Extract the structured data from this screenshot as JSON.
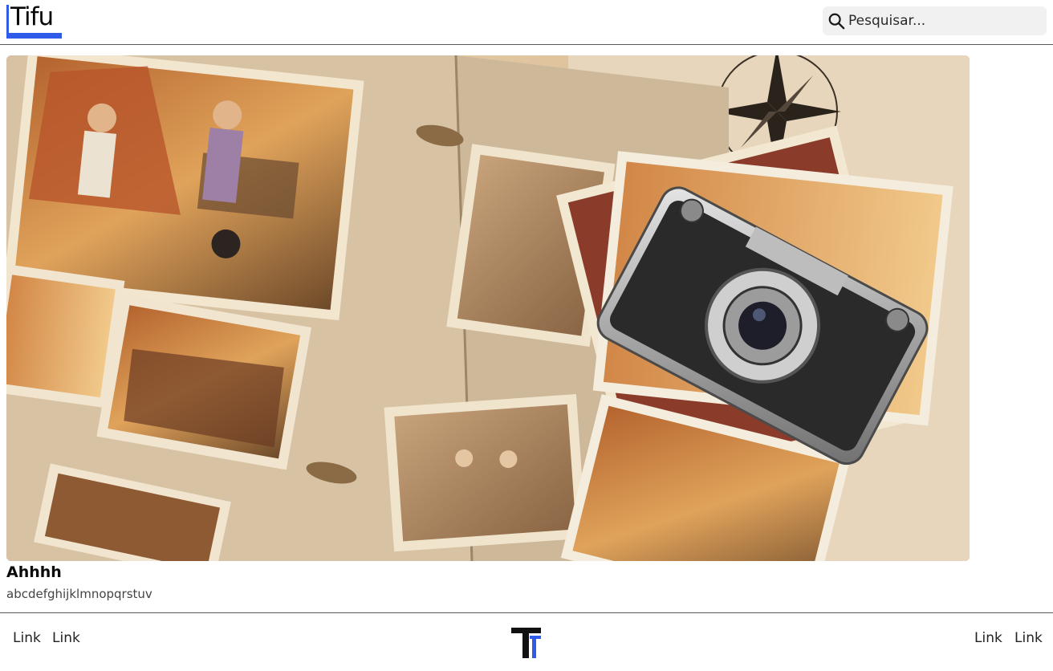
{
  "header": {
    "logo_text": "Tifu",
    "search": {
      "placeholder": "Pesquisar..."
    }
  },
  "hero": {
    "icon": "photo-album-image"
  },
  "card": {
    "title": "Ahhhh",
    "text": "abcdefghijklmnopqrstuv"
  },
  "footer": {
    "left_links": [
      "Link",
      "Link"
    ],
    "right_links": [
      "Link",
      "Link"
    ],
    "logo_icon": "tifu-t-logo"
  },
  "colors": {
    "brand_blue": "#2f5be8",
    "divider": "#5a5a5a",
    "search_bg": "#f1f1f1"
  }
}
